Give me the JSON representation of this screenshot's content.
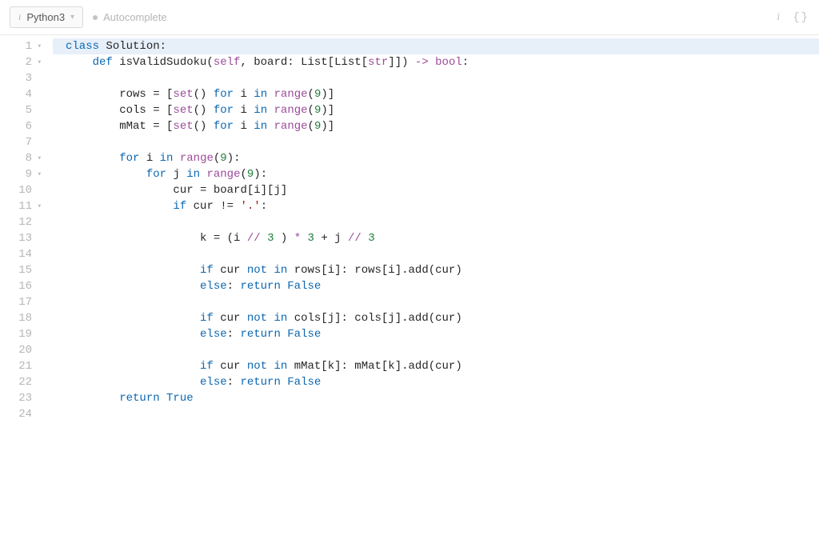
{
  "toolbar": {
    "language": "Python3",
    "autocomplete_label": "Autocomplete"
  },
  "editor": {
    "gutter_rows": [
      {
        "n": "1",
        "fold": true
      },
      {
        "n": "2",
        "fold": true
      },
      {
        "n": "3",
        "fold": false
      },
      {
        "n": "4",
        "fold": false
      },
      {
        "n": "5",
        "fold": false
      },
      {
        "n": "6",
        "fold": false
      },
      {
        "n": "7",
        "fold": false
      },
      {
        "n": "8",
        "fold": true
      },
      {
        "n": "9",
        "fold": true
      },
      {
        "n": "10",
        "fold": false
      },
      {
        "n": "11",
        "fold": true
      },
      {
        "n": "12",
        "fold": false
      },
      {
        "n": "13",
        "fold": false
      },
      {
        "n": "14",
        "fold": false
      },
      {
        "n": "15",
        "fold": false
      },
      {
        "n": "16",
        "fold": false
      },
      {
        "n": "17",
        "fold": false
      },
      {
        "n": "18",
        "fold": false
      },
      {
        "n": "19",
        "fold": false
      },
      {
        "n": "20",
        "fold": false
      },
      {
        "n": "21",
        "fold": false
      },
      {
        "n": "22",
        "fold": false
      },
      {
        "n": "23",
        "fold": false
      },
      {
        "n": "24",
        "fold": false
      }
    ],
    "lines": [
      {
        "t": [
          [
            "class ",
            "tok-kw"
          ],
          [
            "Solution:",
            "tok-plain"
          ]
        ],
        "active": true
      },
      {
        "t": [
          [
            "    ",
            ""
          ],
          [
            "def ",
            "tok-kw"
          ],
          [
            "isValidSudoku(",
            "tok-plain"
          ],
          [
            "self",
            "tok-self"
          ],
          [
            ", board: List[List[",
            "tok-plain"
          ],
          [
            "str",
            "tok-type"
          ],
          [
            "]]) ",
            "tok-plain"
          ],
          [
            "-> ",
            "tok-op"
          ],
          [
            "bool",
            "tok-type"
          ],
          [
            ":",
            "tok-plain"
          ]
        ]
      },
      {
        "t": [
          [
            "",
            ""
          ]
        ]
      },
      {
        "t": [
          [
            "        rows ",
            "tok-plain"
          ],
          [
            "= ",
            "tok-plain"
          ],
          [
            "[",
            "tok-plain"
          ],
          [
            "set",
            "tok-builtin"
          ],
          [
            "() ",
            "tok-plain"
          ],
          [
            "for ",
            "tok-kw"
          ],
          [
            "i ",
            "tok-plain"
          ],
          [
            "in ",
            "tok-kw"
          ],
          [
            "range",
            "tok-builtin"
          ],
          [
            "(",
            "tok-plain"
          ],
          [
            "9",
            "tok-num"
          ],
          [
            ")]",
            "tok-plain"
          ]
        ]
      },
      {
        "t": [
          [
            "        cols ",
            "tok-plain"
          ],
          [
            "= ",
            "tok-plain"
          ],
          [
            "[",
            "tok-plain"
          ],
          [
            "set",
            "tok-builtin"
          ],
          [
            "() ",
            "tok-plain"
          ],
          [
            "for ",
            "tok-kw"
          ],
          [
            "i ",
            "tok-plain"
          ],
          [
            "in ",
            "tok-kw"
          ],
          [
            "range",
            "tok-builtin"
          ],
          [
            "(",
            "tok-plain"
          ],
          [
            "9",
            "tok-num"
          ],
          [
            ")]",
            "tok-plain"
          ]
        ]
      },
      {
        "t": [
          [
            "        mMat ",
            "tok-plain"
          ],
          [
            "= ",
            "tok-plain"
          ],
          [
            "[",
            "tok-plain"
          ],
          [
            "set",
            "tok-builtin"
          ],
          [
            "() ",
            "tok-plain"
          ],
          [
            "for ",
            "tok-kw"
          ],
          [
            "i ",
            "tok-plain"
          ],
          [
            "in ",
            "tok-kw"
          ],
          [
            "range",
            "tok-builtin"
          ],
          [
            "(",
            "tok-plain"
          ],
          [
            "9",
            "tok-num"
          ],
          [
            ")]",
            "tok-plain"
          ]
        ]
      },
      {
        "t": [
          [
            "",
            ""
          ]
        ]
      },
      {
        "t": [
          [
            "        ",
            ""
          ],
          [
            "for ",
            "tok-kw"
          ],
          [
            "i ",
            "tok-plain"
          ],
          [
            "in ",
            "tok-kw"
          ],
          [
            "range",
            "tok-builtin"
          ],
          [
            "(",
            "tok-plain"
          ],
          [
            "9",
            "tok-num"
          ],
          [
            "):",
            "tok-plain"
          ]
        ]
      },
      {
        "t": [
          [
            "            ",
            ""
          ],
          [
            "for ",
            "tok-kw"
          ],
          [
            "j ",
            "tok-plain"
          ],
          [
            "in ",
            "tok-kw"
          ],
          [
            "range",
            "tok-builtin"
          ],
          [
            "(",
            "tok-plain"
          ],
          [
            "9",
            "tok-num"
          ],
          [
            "):",
            "tok-plain"
          ]
        ]
      },
      {
        "t": [
          [
            "                cur ",
            "tok-plain"
          ],
          [
            "= ",
            "tok-plain"
          ],
          [
            "board[i][j]",
            "tok-plain"
          ]
        ]
      },
      {
        "t": [
          [
            "                ",
            ""
          ],
          [
            "if ",
            "tok-kw"
          ],
          [
            "cur ",
            "tok-plain"
          ],
          [
            "!= ",
            "tok-plain"
          ],
          [
            "'.'",
            "tok-str"
          ],
          [
            ":",
            "tok-plain"
          ]
        ]
      },
      {
        "t": [
          [
            "",
            ""
          ]
        ]
      },
      {
        "t": [
          [
            "                    k ",
            "tok-plain"
          ],
          [
            "= ",
            "tok-plain"
          ],
          [
            "(i ",
            "tok-plain"
          ],
          [
            "// ",
            "tok-op"
          ],
          [
            "3 ",
            "tok-num"
          ],
          [
            ") ",
            "tok-plain"
          ],
          [
            "* ",
            "tok-op"
          ],
          [
            "3 ",
            "tok-num"
          ],
          [
            "+ ",
            "tok-plain"
          ],
          [
            "j ",
            "tok-plain"
          ],
          [
            "// ",
            "tok-op"
          ],
          [
            "3",
            "tok-num"
          ]
        ]
      },
      {
        "t": [
          [
            "",
            ""
          ]
        ]
      },
      {
        "t": [
          [
            "                    ",
            ""
          ],
          [
            "if ",
            "tok-kw"
          ],
          [
            "cur ",
            "tok-plain"
          ],
          [
            "not ",
            "tok-not"
          ],
          [
            "in ",
            "tok-kw"
          ],
          [
            "rows[i]: rows[i].add(cur)",
            "tok-plain"
          ]
        ]
      },
      {
        "t": [
          [
            "                    ",
            ""
          ],
          [
            "else",
            "tok-kw"
          ],
          [
            ": ",
            "tok-plain"
          ],
          [
            "return ",
            "tok-kw"
          ],
          [
            "False",
            "tok-bool"
          ]
        ]
      },
      {
        "t": [
          [
            "",
            ""
          ]
        ]
      },
      {
        "t": [
          [
            "                    ",
            ""
          ],
          [
            "if ",
            "tok-kw"
          ],
          [
            "cur ",
            "tok-plain"
          ],
          [
            "not ",
            "tok-not"
          ],
          [
            "in ",
            "tok-kw"
          ],
          [
            "cols[j]: cols[j].add(cur)",
            "tok-plain"
          ]
        ]
      },
      {
        "t": [
          [
            "                    ",
            ""
          ],
          [
            "else",
            "tok-kw"
          ],
          [
            ": ",
            "tok-plain"
          ],
          [
            "return ",
            "tok-kw"
          ],
          [
            "False",
            "tok-bool"
          ]
        ]
      },
      {
        "t": [
          [
            "",
            ""
          ]
        ]
      },
      {
        "t": [
          [
            "                    ",
            ""
          ],
          [
            "if ",
            "tok-kw"
          ],
          [
            "cur ",
            "tok-plain"
          ],
          [
            "not ",
            "tok-not"
          ],
          [
            "in ",
            "tok-kw"
          ],
          [
            "mMat[k]: mMat[k].add(cur)",
            "tok-plain"
          ]
        ]
      },
      {
        "t": [
          [
            "                    ",
            ""
          ],
          [
            "else",
            "tok-kw"
          ],
          [
            ": ",
            "tok-plain"
          ],
          [
            "return ",
            "tok-kw"
          ],
          [
            "False",
            "tok-bool"
          ]
        ]
      },
      {
        "t": [
          [
            "        ",
            ""
          ],
          [
            "return ",
            "tok-kw"
          ],
          [
            "True",
            "tok-bool"
          ]
        ]
      },
      {
        "t": [
          [
            "",
            ""
          ]
        ]
      }
    ]
  }
}
